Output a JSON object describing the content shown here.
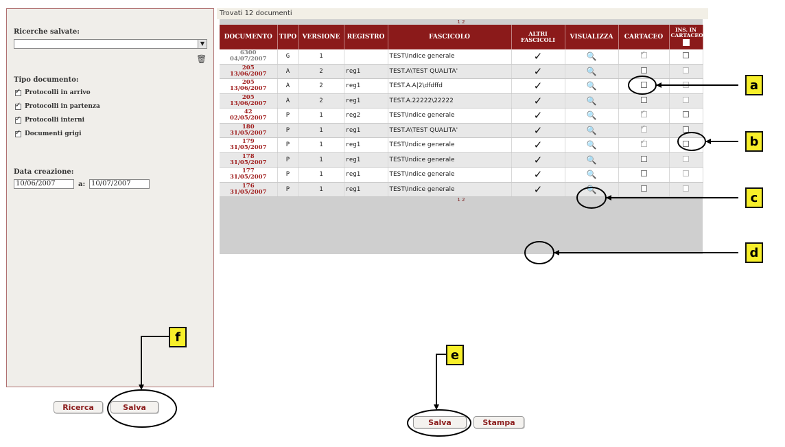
{
  "results": {
    "found_text": "Trovati 12 documenti",
    "pager": "1 2",
    "columns": [
      "DOCUMENTO",
      "TIPO",
      "VERSIONE",
      "REGISTRO",
      "FASCICOLO",
      "ALTRI FASCICOLI",
      "VISUALIZZA",
      "CARTACEO",
      "INS. IN CARTACEO"
    ],
    "rows": [
      {
        "doc_num": "6300",
        "doc_date": "04/07/2007",
        "tipo": "G",
        "versione": "1",
        "registro": "",
        "fascicolo": "TEST\\Indice generale"
      },
      {
        "doc_num": "205",
        "doc_date": "13/06/2007",
        "tipo": "A",
        "versione": "2",
        "registro": "reg1",
        "fascicolo": "TEST.A\\TEST QUALITA'"
      },
      {
        "doc_num": "205",
        "doc_date": "13/06/2007",
        "tipo": "A",
        "versione": "2",
        "registro": "reg1",
        "fascicolo": "TEST.A.A|2\\dfdffd"
      },
      {
        "doc_num": "205",
        "doc_date": "13/06/2007",
        "tipo": "A",
        "versione": "2",
        "registro": "reg1",
        "fascicolo": "TEST.A.22222\\22222"
      },
      {
        "doc_num": "42",
        "doc_date": "02/05/2007",
        "tipo": "P",
        "versione": "1",
        "registro": "reg2",
        "fascicolo": "TEST\\Indice generale"
      },
      {
        "doc_num": "180",
        "doc_date": "31/05/2007",
        "tipo": "P",
        "versione": "1",
        "registro": "reg1",
        "fascicolo": "TEST.A\\TEST QUALITA'"
      },
      {
        "doc_num": "179",
        "doc_date": "31/05/2007",
        "tipo": "P",
        "versione": "1",
        "registro": "reg1",
        "fascicolo": "TEST\\Indice generale"
      },
      {
        "doc_num": "178",
        "doc_date": "31/05/2007",
        "tipo": "P",
        "versione": "1",
        "registro": "reg1",
        "fascicolo": "TEST\\Indice generale"
      },
      {
        "doc_num": "177",
        "doc_date": "31/05/2007",
        "tipo": "P",
        "versione": "1",
        "registro": "reg1",
        "fascicolo": "TEST\\Indice generale"
      },
      {
        "doc_num": "176",
        "doc_date": "31/05/2007",
        "tipo": "P",
        "versione": "1",
        "registro": "reg1",
        "fascicolo": "TEST\\Indice generale"
      }
    ]
  },
  "search_panel": {
    "saved_searches_label": "Ricerche salvate:",
    "doc_type_label": "Tipo documento:",
    "doc_types": [
      {
        "label": "Protocolli in arrivo",
        "checked": true
      },
      {
        "label": "Protocolli in partenza",
        "checked": true
      },
      {
        "label": "Protocolli interni",
        "checked": true
      },
      {
        "label": "Documenti grigi",
        "checked": true
      }
    ],
    "creation_date_label": "Data creazione:",
    "date_from": "10/06/2007",
    "date_to_label": "a:",
    "date_to": "10/07/2007",
    "ricerca_button": "Ricerca",
    "salva_button": "Salva"
  },
  "bottom_actions": {
    "salva_button": "Salva",
    "stampa_button": "Stampa"
  },
  "callouts": [
    "a",
    "b",
    "c",
    "d",
    "e",
    "f"
  ],
  "colors": {
    "header_bg": "#8b1a1a",
    "doc_link": "#a01e1e",
    "callout_fill": "#f7ef2a"
  }
}
